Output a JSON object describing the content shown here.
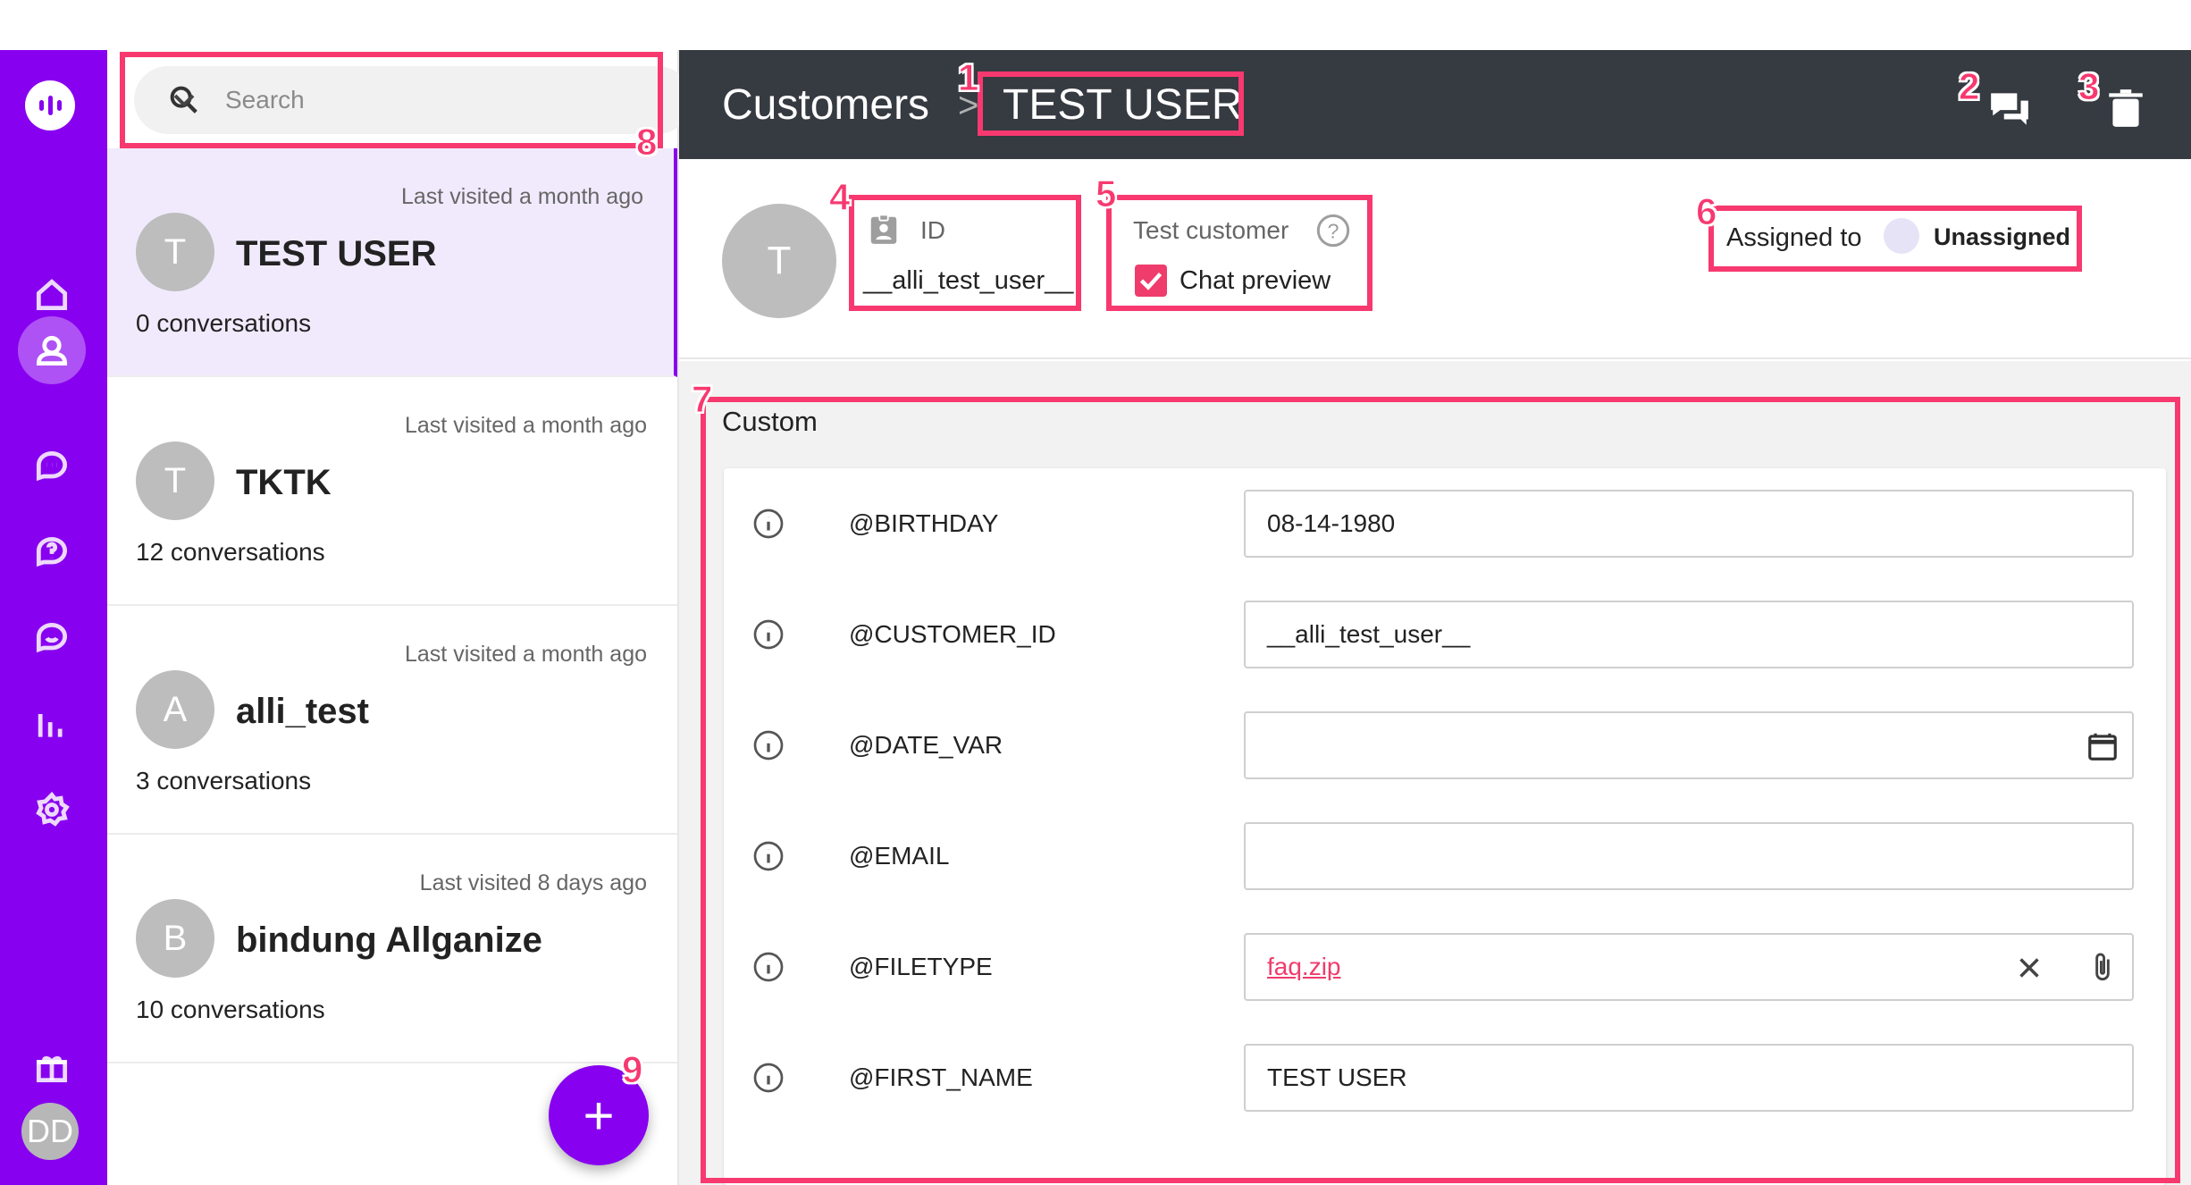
{
  "rail": {
    "avatar_initials": "DD",
    "nav_icons": [
      "home-icon",
      "customers-icon",
      "conversations-icon",
      "faq-icon",
      "chat-icon",
      "analytics-icon",
      "settings-icon",
      "gift-icon"
    ],
    "accent": "#8800f0"
  },
  "search": {
    "placeholder": "Search"
  },
  "customers": [
    {
      "initial": "T",
      "name": "TEST USER",
      "visited": "Last visited a month ago",
      "conversations": "0 conversations",
      "selected": true
    },
    {
      "initial": "T",
      "name": "TKTK",
      "visited": "Last visited a month ago",
      "conversations": "12 conversations"
    },
    {
      "initial": "A",
      "name": "alli_test",
      "visited": "Last visited a month ago",
      "conversations": "3 conversations"
    },
    {
      "initial": "B",
      "name": "bindung Allganize",
      "visited": "Last visited 8 days ago",
      "conversations": "10 conversations"
    }
  ],
  "fab": {
    "label": "+"
  },
  "header": {
    "section": "Customers",
    "separator": ">",
    "current": "TEST USER"
  },
  "profile": {
    "avatar_initial": "T",
    "id_label": "ID",
    "id_value": "__alli_test_user__",
    "test_customer_label": "Test customer",
    "help_symbol": "?",
    "chat_preview_label": "Chat preview",
    "chat_preview_checked": true,
    "assigned_label": "Assigned to",
    "assignee": "Unassigned"
  },
  "custom": {
    "title": "Custom",
    "fields": [
      {
        "label": "@BIRTHDAY",
        "value": "08-14-1980"
      },
      {
        "label": "@CUSTOMER_ID",
        "value": "__alli_test_user__"
      },
      {
        "label": "@DATE_VAR",
        "value": ""
      },
      {
        "label": "@EMAIL",
        "value": ""
      },
      {
        "label": "@FILETYPE",
        "value": "faq.zip"
      },
      {
        "label": "@FIRST_NAME",
        "value": "TEST USER"
      }
    ]
  },
  "annotations": [
    "1",
    "2",
    "3",
    "4",
    "5",
    "6",
    "7",
    "8",
    "9"
  ],
  "colors": {
    "highlight": "#f73970",
    "link": "#ef3c6c",
    "header_bg": "#363a41"
  }
}
